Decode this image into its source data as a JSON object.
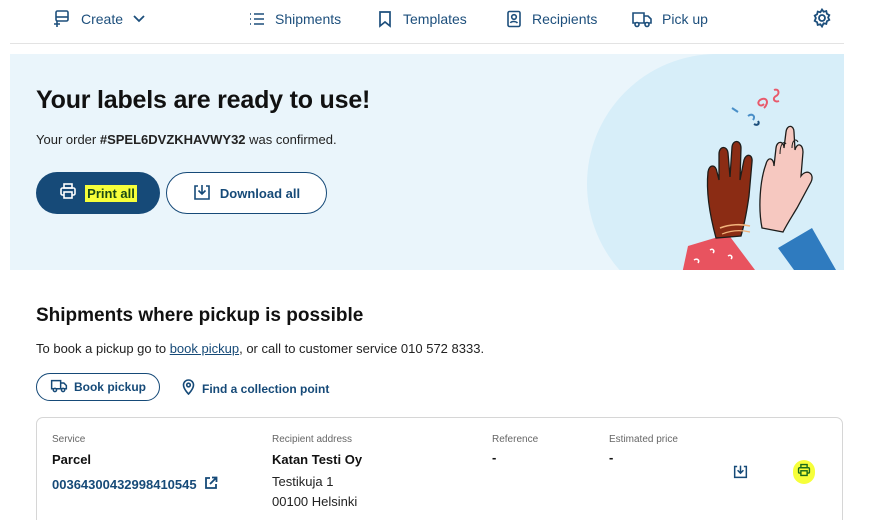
{
  "nav": {
    "create_label": "Create",
    "shipments_label": "Shipments",
    "templates_label": "Templates",
    "recipients_label": "Recipients",
    "pickup_label": "Pick up"
  },
  "hero": {
    "title": "Your labels are ready to use!",
    "order_prefix": "Your order ",
    "order_number": "#SPEL6DVZKHAVWY32",
    "order_suffix": " was confirmed.",
    "print_all_label": "Print all",
    "download_all_label": "Download all"
  },
  "pickup": {
    "title": "Shipments where pickup is possible",
    "text_before": "To book a pickup go to ",
    "link_text": "book pickup",
    "text_after": ", or call to customer service 010 572 8333.",
    "book_pickup_label": "Book pickup",
    "find_point_label": "Find a collection point"
  },
  "shipment": {
    "service_label": "Service",
    "service_value": "Parcel",
    "tracking_number": "00364300432998410545",
    "recipient_label": "Recipient address",
    "recipient_name": "Katan Testi Oy",
    "recipient_street": "Testikuja 1",
    "recipient_city": "00100 Helsinki",
    "reference_label": "Reference",
    "reference_value": "-",
    "price_label": "Estimated price",
    "price_value": "-"
  },
  "colors": {
    "brand": "#164a78",
    "highlight": "#f6ff3a",
    "hero_bg": "#eaf5fb"
  },
  "icons": [
    "create-icon",
    "chevron-down-icon",
    "list-icon",
    "bookmark-icon",
    "contact-icon",
    "truck-icon",
    "gear-icon",
    "printer-icon",
    "download-icon",
    "location-pin-icon",
    "external-link-icon"
  ]
}
